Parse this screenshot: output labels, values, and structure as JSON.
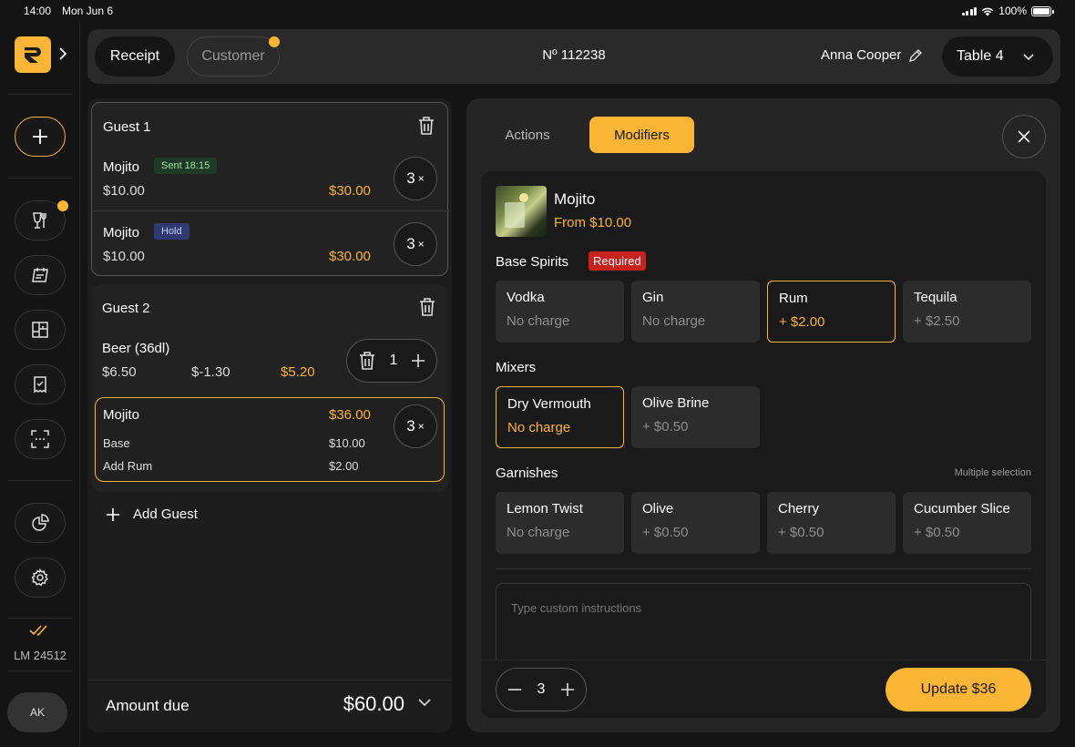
{
  "status_bar": {
    "time": "14:00",
    "date": "Mon Jun 6",
    "battery": "100%"
  },
  "rail": {
    "lm_label": "LM 24512",
    "avatar_initials": "AK"
  },
  "topbar": {
    "receipt_tab": "Receipt",
    "customer_tab": "Customer",
    "order_number": "Nº 112238",
    "staff_name": "Anna Cooper",
    "table_label": "Table 4"
  },
  "guests": [
    {
      "title": "Guest 1",
      "items": [
        {
          "name": "Mojito",
          "badge": "Sent 18:15",
          "unit_price": "$10.00",
          "total": "$30.00",
          "qty": "3"
        },
        {
          "name": "Mojito",
          "badge": "Hold",
          "unit_price": "$10.00",
          "total": "$30.00",
          "qty": "3"
        }
      ]
    },
    {
      "title": "Guest 2",
      "items": [
        {
          "name": "Beer (36dl)",
          "unit_price": "$6.50",
          "discount": "$-1.30",
          "total": "$5.20",
          "qty": "1"
        },
        {
          "name": "Mojito",
          "total": "$36.00",
          "qty": "3",
          "lines": [
            {
              "label": "Base",
              "value": "$10.00"
            },
            {
              "label": "Add Rum",
              "value": "$2.00"
            }
          ]
        }
      ]
    }
  ],
  "qty_suffix": "×",
  "add_guest_label": "Add Guest",
  "amount_due": {
    "label": "Amount due",
    "value": "$60.00"
  },
  "right": {
    "tabs": {
      "actions": "Actions",
      "modifiers": "Modifiers"
    },
    "product": {
      "name": "Mojito",
      "price": "From $10.00"
    },
    "sections": {
      "base": {
        "title": "Base Spirits",
        "required": "Required",
        "options": [
          {
            "name": "Vodka",
            "price": "No charge"
          },
          {
            "name": "Gin",
            "price": "No charge"
          },
          {
            "name": "Rum",
            "price": "+ $2.00"
          },
          {
            "name": "Tequila",
            "price": "+ $2.50"
          }
        ]
      },
      "mixers": {
        "title": "Mixers",
        "options": [
          {
            "name": "Dry Vermouth",
            "price": "No charge"
          },
          {
            "name": "Olive Brine",
            "price": "+ $0.50"
          }
        ]
      },
      "garnishes": {
        "title": "Garnishes",
        "note": "Multiple selection",
        "options": [
          {
            "name": "Lemon Twist",
            "price": "No charge"
          },
          {
            "name": "Olive",
            "price": "+ $0.50"
          },
          {
            "name": "Cherry",
            "price": "+ $0.50"
          },
          {
            "name": "Cucumber Slice",
            "price": "+ $0.50"
          }
        ]
      }
    },
    "instructions_placeholder": "Type custom instructions",
    "quantity": "3",
    "update_button": "Update $36"
  },
  "colors": {
    "accent": "#f9b533",
    "background": "#141414",
    "panel": "#252525",
    "required": "#c7221f"
  }
}
